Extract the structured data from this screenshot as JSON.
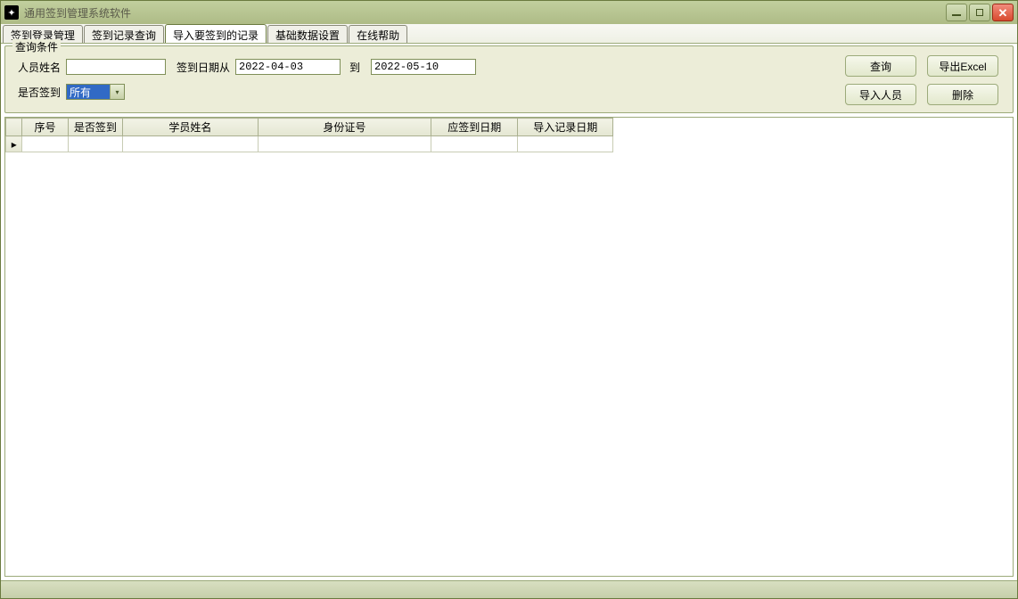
{
  "window": {
    "title": "通用签到管理系统软件"
  },
  "tabs": [
    {
      "label": "签到登录管理"
    },
    {
      "label": "签到记录查询"
    },
    {
      "label": "导入要签到的记录"
    },
    {
      "label": "基础数据设置"
    },
    {
      "label": "在线帮助"
    }
  ],
  "group": {
    "title": "查询条件",
    "name_label": "人员姓名",
    "name_value": "",
    "date_from_label": "签到日期从",
    "date_from_value": "2022-04-03",
    "date_to_label": "到",
    "date_to_value": "2022-05-10",
    "signed_label": "是否签到",
    "signed_value": "所有"
  },
  "buttons": {
    "query": "查询",
    "export": "导出Excel",
    "import": "导入人员",
    "delete": "删除"
  },
  "columns": {
    "seq": "序号",
    "signed": "是否签到",
    "student_name": "学员姓名",
    "id_number": "身份证号",
    "should_sign_date": "应签到日期",
    "import_date": "导入记录日期"
  },
  "rows": [
    {
      "seq": "",
      "signed": "",
      "student_name": "",
      "id_number": "",
      "should_sign_date": "",
      "import_date": ""
    }
  ]
}
